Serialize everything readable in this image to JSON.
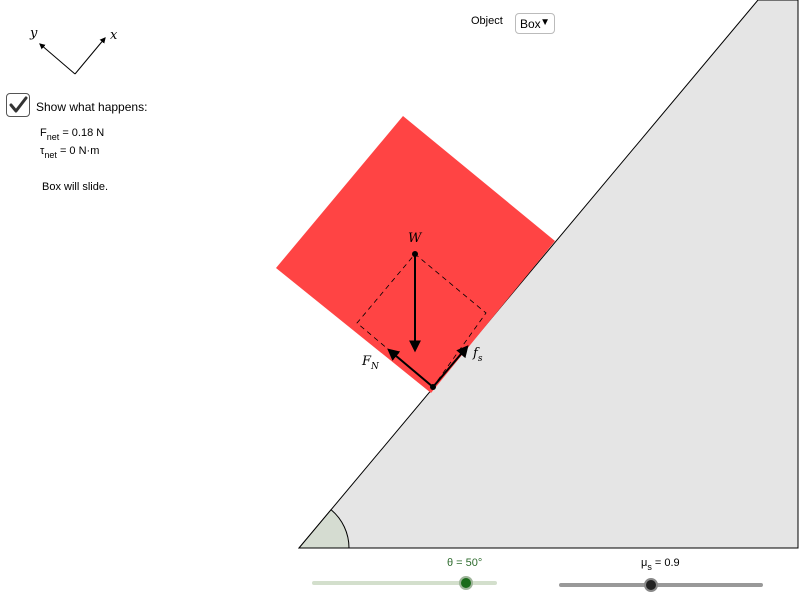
{
  "axes": {
    "x_label": "x",
    "y_label": "y"
  },
  "show_toggle": {
    "label": "Show what happens:",
    "checked": true
  },
  "readouts": {
    "fnet_symbol": "F",
    "fnet_sub": "net",
    "fnet_value": "= 0.18 N",
    "tnet_symbol": "τ",
    "tnet_sub": "net",
    "tnet_value": "= 0 N·m",
    "outcome": "Box will slide."
  },
  "object_select": {
    "label": "Object",
    "value": "Box"
  },
  "forces": {
    "weight": "W",
    "normal": "F",
    "normal_sub": "N",
    "friction": "f",
    "friction_sub": "s"
  },
  "sliders": {
    "theta": {
      "label": "θ = 50°",
      "value_deg": 50,
      "min": 0,
      "max": 60
    },
    "mu": {
      "label": "μ",
      "label_sub": "s",
      "value_text": "= 0.9",
      "value": 0.9,
      "min": 0,
      "max": 2
    }
  },
  "colors": {
    "box": "#ff4444",
    "incline": "#e5e5e5",
    "angle_fill": "#d5dcd1",
    "theta_label": "#2e6b2e",
    "theta_track": "#d3dfcc",
    "theta_knob": "#1a6b1a",
    "mu_track": "#999999",
    "mu_knob": "#222222"
  }
}
